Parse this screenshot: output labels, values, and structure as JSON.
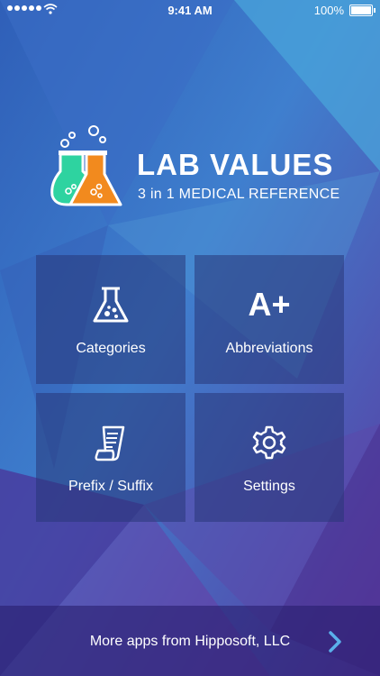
{
  "status_bar": {
    "time": "9:41 AM",
    "battery": "100%"
  },
  "header": {
    "title": "LAB VALUES",
    "subtitle": "3 in 1 MEDICAL REFERENCE"
  },
  "menu": [
    {
      "label": "Categories",
      "icon": "flask-icon"
    },
    {
      "label": "Abbreviations",
      "icon": "a-plus-icon",
      "icon_text": "A+"
    },
    {
      "label": "Prefix / Suffix",
      "icon": "scroll-icon"
    },
    {
      "label": "Settings",
      "icon": "gear-icon"
    }
  ],
  "footer": {
    "text": "More apps from Hipposoft, LLC"
  },
  "colors": {
    "accent_blue": "#3b9be0",
    "flask_green": "#2ed3a0",
    "flask_orange": "#f28a1e",
    "chevron": "#5ab0ea"
  }
}
